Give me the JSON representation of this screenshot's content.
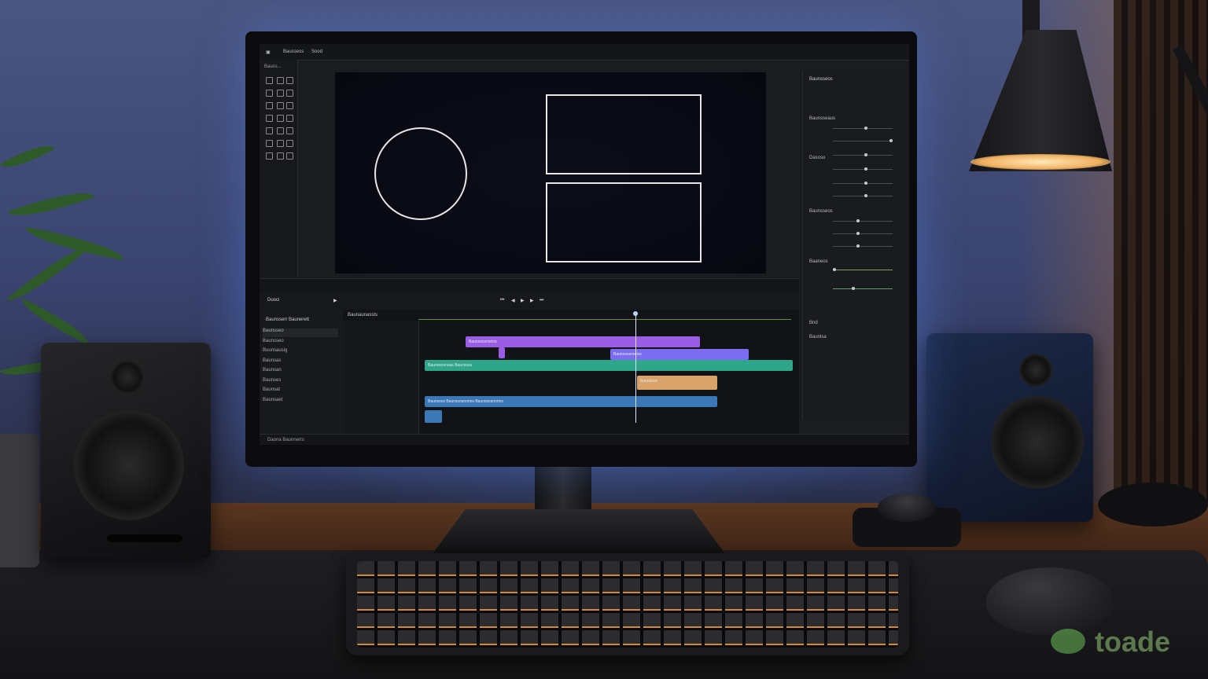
{
  "scene": {
    "description_tags": [
      "desk",
      "monitor",
      "video-editor",
      "speakers",
      "lamp",
      "keyboard",
      "mouse",
      "plant"
    ]
  },
  "editor": {
    "window_title": "Bausseos",
    "menu_item": "Sood",
    "tools_label": "Bauss...",
    "transport_label": "Duoci",
    "layers_header": "Baunsserr Baunerett",
    "layers": [
      "Baunsseo",
      "Baunsseo",
      "Buunsausig",
      "Baunsas",
      "Baunsan",
      "Baunses",
      "Baunsat",
      "Baunsaet"
    ],
    "timeline_header": "Baunaunassts",
    "status_left": "Daona Baunnerts",
    "props_header": "Baunsseos",
    "props_sections": [
      "Baunsseaus",
      "Dasoso",
      "Baunsseos",
      "Baaneos",
      "Bnd",
      "Baunlsa"
    ],
    "clips": [
      {
        "label": "Baunssosnorios",
        "color": "#9b5de5"
      },
      {
        "label": "Baunssoenreios",
        "color": "#7b6cf0"
      },
      {
        "label": "Baunssosneas  Baunssos",
        "color": "#2fa58a"
      },
      {
        "label": "Baunssos",
        "color": "#d9a36a"
      },
      {
        "label": "Baunssos  Baunssosnorios  Baunssosnorios",
        "color": "#3b78b8"
      }
    ]
  },
  "watermark": "toade"
}
